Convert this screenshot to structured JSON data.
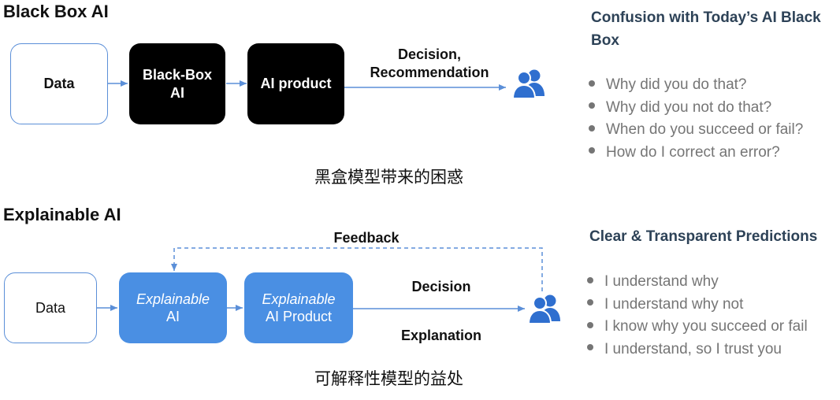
{
  "top": {
    "title": "Black Box AI",
    "nodes": {
      "data": "Data",
      "black_box": [
        "Black-Box",
        "AI"
      ],
      "product": "AI product"
    },
    "edge_label": [
      "Decision,",
      "Recommendation"
    ],
    "caption": "黑盒模型带来的困惑",
    "panel": {
      "title": [
        "Confusion with Today’s AI Black",
        "Box"
      ],
      "bullets": [
        "Why did you do that?",
        "Why did you not do that?",
        "When do you succeed or fail?",
        "How do I correct an error?"
      ]
    }
  },
  "bottom": {
    "title": "Explainable AI",
    "nodes": {
      "data": "Data",
      "explainable_ai": [
        "Explainable",
        "AI"
      ],
      "explainable_product": [
        "Explainable",
        "AI Product"
      ]
    },
    "feedback_label": "Feedback",
    "decision_label": "Decision",
    "explanation_label": "Explanation",
    "caption": "可解释性模型的益处",
    "panel": {
      "title": "Clear & Transparent Predictions",
      "bullets": [
        "I understand why",
        "I understand why not",
        "I know why you succeed or fail",
        "I understand, so I trust you"
      ]
    }
  },
  "colors": {
    "accent_blue": "#4a8fe3",
    "arrow": "#5b8fd8",
    "user_icon": "#2f6fcf",
    "panel_title": "#2d4257",
    "bullet_text": "#757575"
  },
  "icons": {
    "user": "users-icon"
  }
}
